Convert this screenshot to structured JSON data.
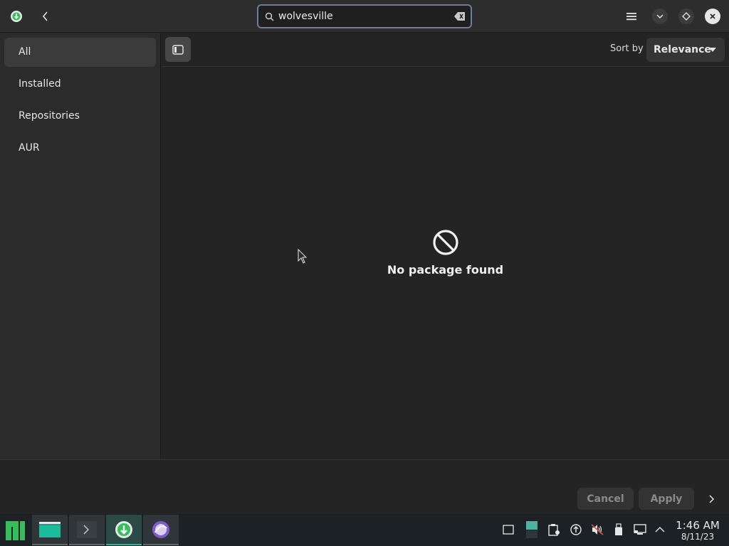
{
  "header": {
    "search_value": "wolvesville",
    "icons": {
      "app": "software-manager-icon",
      "back": "chevron-left-icon",
      "search": "search-icon",
      "clear": "backspace-clear-icon",
      "menu": "hamburger-menu-icon",
      "minimize": "chevron-down-icon",
      "maximize": "diamond-icon",
      "close": "close-icon"
    }
  },
  "sidebar": {
    "items": [
      {
        "label": "All",
        "active": true
      },
      {
        "label": "Installed",
        "active": false
      },
      {
        "label": "Repositories",
        "active": false
      },
      {
        "label": "AUR",
        "active": false
      }
    ]
  },
  "toolbar": {
    "sort_label": "Sort by",
    "sort_value": "Relevance"
  },
  "empty_state": {
    "message": "No package found",
    "icon": "no-entry-icon"
  },
  "actions": {
    "cancel_label": "Cancel",
    "apply_label": "Apply"
  },
  "taskbar": {
    "clock_time": "1:46 AM",
    "clock_date": "8/11/23",
    "apps": [
      "file-manager",
      "terminal",
      "software-manager",
      "browser"
    ]
  },
  "colors": {
    "accent": "#3fa89a",
    "window_bg": "#242424",
    "sidebar_bg": "#2b2b2b",
    "search_border": "#6a7fa0"
  }
}
